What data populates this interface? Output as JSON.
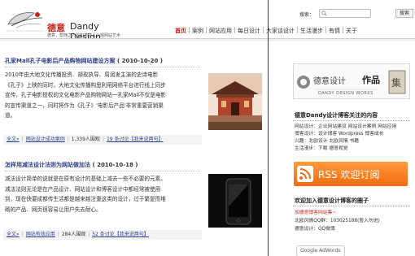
{
  "header": {
    "logo_cn": "德意",
    "logo_en": "Dandy Design",
    "logo_slogan": "德意，帮随之人的和德意人小题网站艺术",
    "search_label": "搜索：",
    "search_placeholder": "",
    "search_button": "搜索"
  },
  "nav": {
    "items": [
      "首页",
      "案例",
      "网站应用",
      "每日设计",
      "大家谈设计",
      "生活漫步",
      "有情",
      "关于"
    ]
  },
  "posts": [
    {
      "title": "孔家Mall孔子电影后产品购物网站建设方案",
      "date": "( 2010-10-20 )",
      "body_lines": [
        "2010年由大地文化传播投资、胡玫执导、周润发主演的史诗电影",
        "《孔子》上映的同时，大地文化传播构思利用网络平台进行线上同步",
        "宣传，孔子电影授权的文化电影产品购物网站一孔家Mall不仅是电影",
        "的宣传渠道之一，同时将作为《孔子》'电影后产品'非常重要营销渠",
        "道。"
      ],
      "meta": {
        "read_all": "全文»",
        "category": "网站设计成功案例",
        "views": "1,339人围观",
        "comments": "19 条讨论【我来说两句】"
      }
    },
    {
      "title": "怎样用减法设计法则为网站做加法",
      "date": "( 2010-10-18 )",
      "body_lines": [
        "减法设计简单的说就是在原有设计的基础上减去一些不必要的元素。",
        "减法法则无论是在产品设计、网站设计和博客设计中都经常被使用",
        "到，现在快要成都传生活都是越来越注重这类的设计，过于繁复而堆",
        "砌的产品、网页很容易让用户失去耐心。"
      ],
      "meta": {
        "read_all": "全文»",
        "category": "网站有效应用",
        "views": "284人围观",
        "comments": "52 条讨论【我来说两句】"
      }
    }
  ],
  "sidebar": {
    "ad_cn": "德意设计",
    "ad_title": "作品",
    "ad_en": "DANDY DESIGN WORKS",
    "ad_seal": "集",
    "section1_title": "德意Dandy设计博客关注的内容",
    "section1_lines": [
      "网站设计：企业网站建设 网站设计案例 网站应用",
      "博客设计：设计博客 Wordpress 博客成长",
      "兴趣：北欧设计 北欧风情 书籍",
      "生活漫步：下载 德意视觉"
    ],
    "rss_text": "RSS 欢迎订阅",
    "section2_title": "欢迎加入德意设计博客的圈子",
    "section2_lines": [
      "加德意博客网站集~",
      "北欧风情QQ群：103025188(暂入勿进)",
      "德意设计：QQ微博"
    ],
    "adwords_label": "Google AdWords"
  },
  "colors": {
    "accent_red": "#d21b1b",
    "link_blue": "#2c3f8b",
    "rss_orange": "#f26b10"
  }
}
